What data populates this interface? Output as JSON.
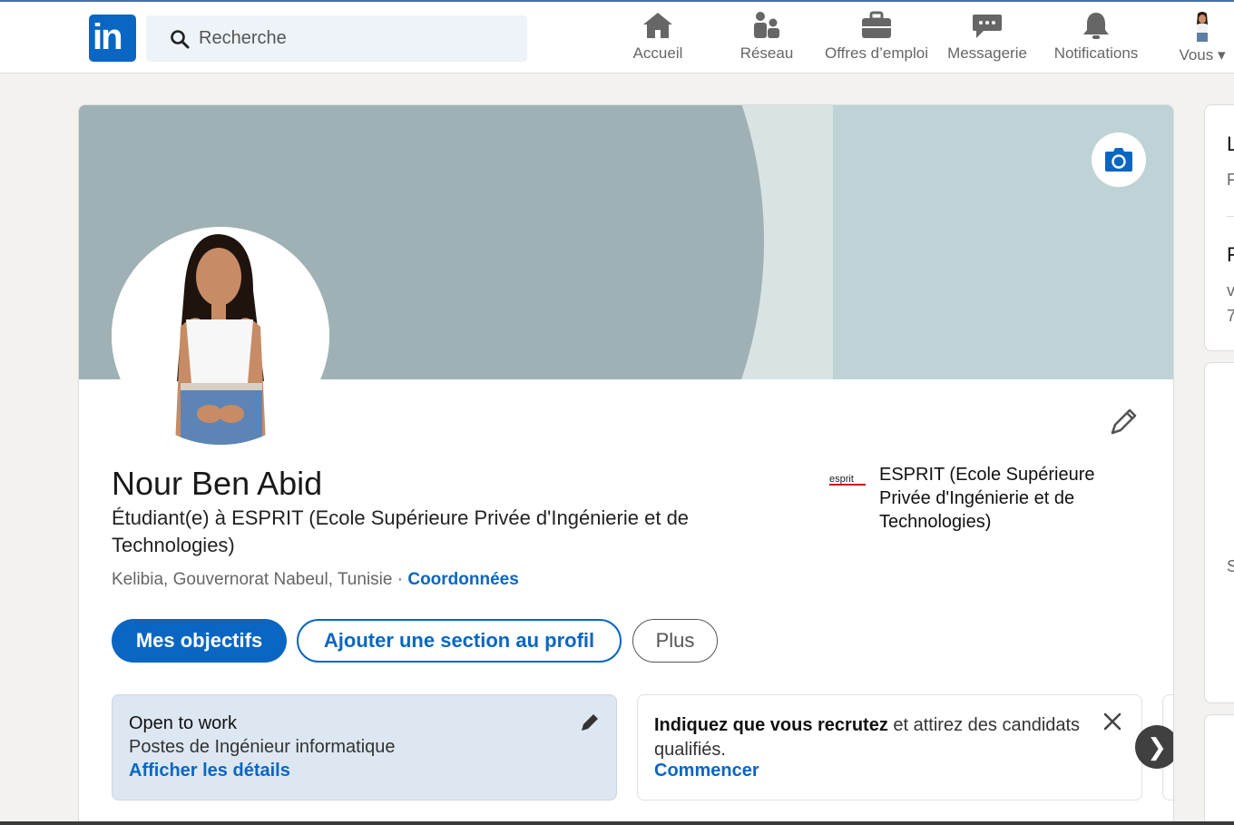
{
  "nav": {
    "search_placeholder": "Recherche",
    "items": [
      {
        "label": "Accueil",
        "icon": "home-icon"
      },
      {
        "label": "Réseau",
        "icon": "network-icon"
      },
      {
        "label": "Offres d’emploi",
        "icon": "briefcase-icon"
      },
      {
        "label": "Messagerie",
        "icon": "messaging-icon"
      },
      {
        "label": "Notifications",
        "icon": "bell-icon"
      },
      {
        "label": "Vous",
        "icon": "avatar"
      }
    ]
  },
  "profile": {
    "name": "Nour Ben Abid",
    "headline": "Étudiant(e) à ESPRIT (Ecole Supérieure Privée d'Ingénierie et de Technologies)",
    "location": "Kelibia, Gouvernorat Nabeul, Tunisie ·",
    "contact_link": "Coordonnées",
    "education": "ESPRIT (Ecole Supérieure Privée d'Ingénierie et de Technologies)",
    "edu_logo_text": "esprit"
  },
  "actions": {
    "primary": "Mes objectifs",
    "add_section": "Ajouter une section au profil",
    "more": "Plus"
  },
  "open_to_work": {
    "title": "Open to work",
    "roles": "Postes de Ingénieur informatique",
    "link": "Afficher les détails"
  },
  "hiring": {
    "bold": "Indiquez que vous recrutez",
    "rest": " et attirez des candidats qualifiés.",
    "link": "Commencer"
  },
  "sidebar": {
    "c1_title": "L",
    "c1_sub": "F",
    "c2_title": "F",
    "c2_sub1": "v",
    "c2_sub2": "7",
    "c3_sub": "S"
  },
  "colors": {
    "brand": "#0a66c2",
    "banner_base": "#bfd3d6",
    "banner_arc": "#9fb1b4",
    "banner_stripe": "#d8e3e4",
    "open_to_work_bg": "#dde7f1"
  }
}
